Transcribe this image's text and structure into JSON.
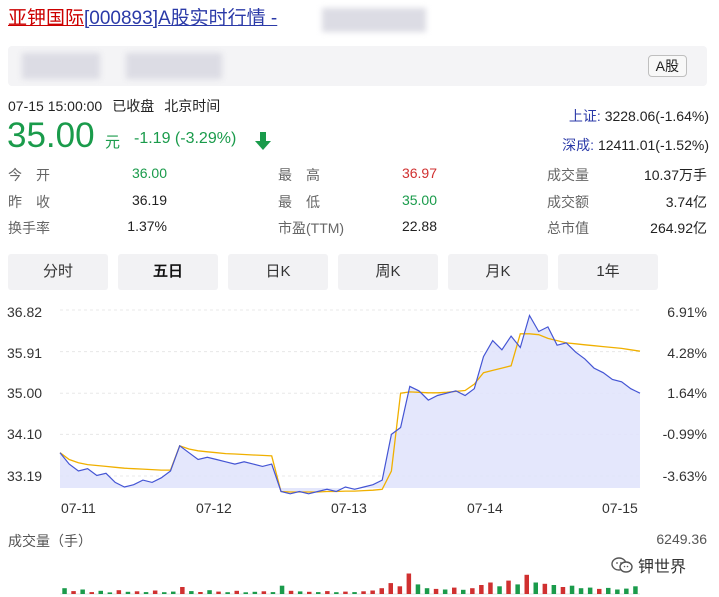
{
  "title": {
    "name": "亚钾国际",
    "code": "[000893]",
    "suffix": "A股实时行情 -"
  },
  "market_tag": "A股",
  "status": {
    "datetime": "07-15 15:00:00",
    "state": "已收盘",
    "tz": "北京时间"
  },
  "quote": {
    "price": "35.00",
    "unit": "元",
    "change": "-1.19 (-3.29%)"
  },
  "indices": [
    {
      "name": "上证:",
      "value": "3228.06(-1.64%)"
    },
    {
      "name": "深成:",
      "value": "12411.01(-1.52%)"
    }
  ],
  "stats": [
    {
      "label": "今　开",
      "value": "36.00",
      "tone": "green"
    },
    {
      "label": "最　高",
      "value": "36.97",
      "tone": "red"
    },
    {
      "label": "成交量",
      "value": "10.37万手",
      "tone": "dark"
    },
    {
      "label": "昨　收",
      "value": "36.19",
      "tone": "dark"
    },
    {
      "label": "最　低",
      "value": "35.00",
      "tone": "green"
    },
    {
      "label": "成交额",
      "value": "3.74亿",
      "tone": "dark"
    },
    {
      "label": "换手率",
      "value": "1.37%",
      "tone": "dark"
    },
    {
      "label": "市盈(TTM)",
      "value": "22.88",
      "tone": "dark"
    },
    {
      "label": "总市值",
      "value": "264.92亿",
      "tone": "dark"
    }
  ],
  "tabs": [
    "分时",
    "五日",
    "日K",
    "周K",
    "月K",
    "1年"
  ],
  "active_tab": 1,
  "colors": {
    "up": "#d03030",
    "down": "#1a9b4b",
    "price_line": "#4455d4",
    "avg_line": "#f0b000",
    "area_fill": "#dfe3fb"
  },
  "chart_data": {
    "type": "line",
    "title": "",
    "x_ticks": [
      "07-11",
      "07-12",
      "07-13",
      "07-14",
      "07-15"
    ],
    "y_ticks": [
      "36.82",
      "35.91",
      "35.00",
      "34.10",
      "33.19"
    ],
    "y_pct_ticks": [
      "6.91%",
      "4.28%",
      "1.64%",
      "-0.99%",
      "-3.63%"
    ],
    "ylim": [
      33.0,
      37.0
    ],
    "grid": true,
    "series": [
      {
        "role": "price",
        "values": [
          33.7,
          33.45,
          33.3,
          33.35,
          33.2,
          33.25,
          33.05,
          32.95,
          33.0,
          33.1,
          33.05,
          33.15,
          33.3,
          33.85,
          33.7,
          33.55,
          33.6,
          33.55,
          33.5,
          33.45,
          33.5,
          33.45,
          33.4,
          33.45,
          32.85,
          32.8,
          32.85,
          32.8,
          32.85,
          32.9,
          32.85,
          32.95,
          32.9,
          32.95,
          33.0,
          33.1,
          34.1,
          34.25,
          35.15,
          35.05,
          34.85,
          34.95,
          35.0,
          35.05,
          34.95,
          35.1,
          35.8,
          36.15,
          35.95,
          36.25,
          36.0,
          36.7,
          36.35,
          36.45,
          36.05,
          36.1,
          35.9,
          35.75,
          35.55,
          35.45,
          35.3,
          35.25,
          35.1,
          35.0
        ],
        "session_lengths": [
          13,
          12,
          13,
          13,
          13
        ]
      },
      {
        "role": "average",
        "values": [
          33.7,
          33.55,
          33.48,
          33.44,
          33.42,
          33.4,
          33.38,
          33.36,
          33.35,
          33.34,
          33.33,
          33.32,
          33.32,
          33.85,
          33.78,
          33.74,
          33.72,
          33.7,
          33.68,
          33.67,
          33.66,
          33.65,
          33.64,
          33.63,
          32.85,
          32.84,
          32.84,
          32.84,
          32.84,
          32.85,
          32.85,
          32.86,
          32.86,
          32.87,
          32.88,
          32.9,
          33.3,
          35.0,
          35.03,
          35.02,
          35.01,
          35.01,
          35.02,
          35.04,
          35.06,
          35.2,
          35.45,
          35.5,
          35.55,
          35.6,
          36.3,
          36.3,
          36.28,
          36.2,
          36.15,
          36.1,
          36.08,
          36.06,
          36.04,
          36.02,
          36.0,
          35.98,
          35.95,
          35.92
        ]
      }
    ]
  },
  "volume": {
    "title": "成交量（手）",
    "max_label": "6249.36",
    "max": 6249.36,
    "bars": [
      {
        "v": 900,
        "c": "down"
      },
      {
        "v": 450,
        "c": "up"
      },
      {
        "v": 700,
        "c": "down"
      },
      {
        "v": 300,
        "c": "up"
      },
      {
        "v": 500,
        "c": "down"
      },
      {
        "v": 250,
        "c": "down"
      },
      {
        "v": 600,
        "c": "up"
      },
      {
        "v": 350,
        "c": "down"
      },
      {
        "v": 420,
        "c": "up"
      },
      {
        "v": 300,
        "c": "down"
      },
      {
        "v": 550,
        "c": "up"
      },
      {
        "v": 280,
        "c": "down"
      },
      {
        "v": 380,
        "c": "down"
      },
      {
        "v": 1100,
        "c": "up"
      },
      {
        "v": 450,
        "c": "down"
      },
      {
        "v": 320,
        "c": "up"
      },
      {
        "v": 600,
        "c": "down"
      },
      {
        "v": 380,
        "c": "up"
      },
      {
        "v": 280,
        "c": "down"
      },
      {
        "v": 500,
        "c": "up"
      },
      {
        "v": 260,
        "c": "down"
      },
      {
        "v": 350,
        "c": "down"
      },
      {
        "v": 420,
        "c": "up"
      },
      {
        "v": 300,
        "c": "down"
      },
      {
        "v": 1300,
        "c": "down"
      },
      {
        "v": 500,
        "c": "up"
      },
      {
        "v": 400,
        "c": "down"
      },
      {
        "v": 350,
        "c": "up"
      },
      {
        "v": 300,
        "c": "down"
      },
      {
        "v": 450,
        "c": "up"
      },
      {
        "v": 280,
        "c": "down"
      },
      {
        "v": 380,
        "c": "up"
      },
      {
        "v": 300,
        "c": "down"
      },
      {
        "v": 420,
        "c": "up"
      },
      {
        "v": 550,
        "c": "up"
      },
      {
        "v": 900,
        "c": "up"
      },
      {
        "v": 1700,
        "c": "up"
      },
      {
        "v": 1200,
        "c": "up"
      },
      {
        "v": 3200,
        "c": "up"
      },
      {
        "v": 1500,
        "c": "down"
      },
      {
        "v": 900,
        "c": "down"
      },
      {
        "v": 800,
        "c": "up"
      },
      {
        "v": 700,
        "c": "down"
      },
      {
        "v": 1000,
        "c": "up"
      },
      {
        "v": 650,
        "c": "down"
      },
      {
        "v": 900,
        "c": "up"
      },
      {
        "v": 1400,
        "c": "up"
      },
      {
        "v": 1800,
        "c": "up"
      },
      {
        "v": 1200,
        "c": "down"
      },
      {
        "v": 2100,
        "c": "up"
      },
      {
        "v": 1500,
        "c": "down"
      },
      {
        "v": 3000,
        "c": "up"
      },
      {
        "v": 1800,
        "c": "down"
      },
      {
        "v": 1600,
        "c": "up"
      },
      {
        "v": 1400,
        "c": "down"
      },
      {
        "v": 1100,
        "c": "up"
      },
      {
        "v": 1300,
        "c": "down"
      },
      {
        "v": 900,
        "c": "down"
      },
      {
        "v": 1000,
        "c": "down"
      },
      {
        "v": 800,
        "c": "up"
      },
      {
        "v": 950,
        "c": "down"
      },
      {
        "v": 700,
        "c": "down"
      },
      {
        "v": 850,
        "c": "down"
      },
      {
        "v": 1200,
        "c": "down"
      }
    ]
  },
  "watermark": {
    "icon": "wechat-icon",
    "text": "钾世界"
  }
}
